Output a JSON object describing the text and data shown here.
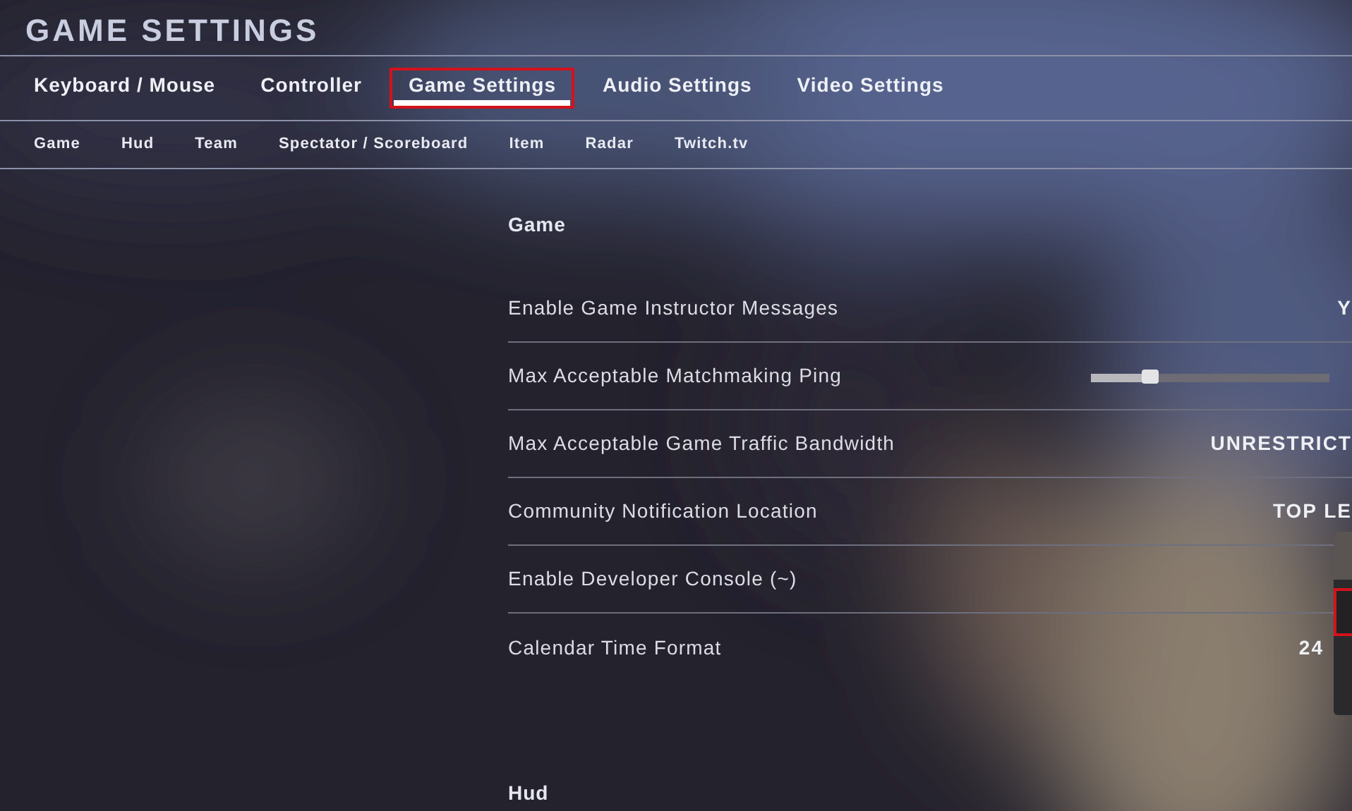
{
  "title": "GAME SETTINGS",
  "tabs": [
    {
      "label": "Keyboard / Mouse",
      "selected": false,
      "highlighted": false
    },
    {
      "label": "Controller",
      "selected": false,
      "highlighted": false
    },
    {
      "label": "Game Settings",
      "selected": true,
      "highlighted": true
    },
    {
      "label": "Audio Settings",
      "selected": false,
      "highlighted": false
    },
    {
      "label": "Video Settings",
      "selected": false,
      "highlighted": false
    }
  ],
  "subtabs": [
    {
      "label": "Game"
    },
    {
      "label": "Hud"
    },
    {
      "label": "Team"
    },
    {
      "label": "Spectator / Scoreboard"
    },
    {
      "label": "Item"
    },
    {
      "label": "Radar"
    },
    {
      "label": "Twitch.tv"
    }
  ],
  "section": {
    "title": "Game"
  },
  "settings": [
    {
      "kind": "value",
      "label": "Enable Game Instructor Messages",
      "value": "Y"
    },
    {
      "kind": "slider",
      "label": "Max Acceptable Matchmaking Ping",
      "level": 0.25
    },
    {
      "kind": "value",
      "label": "Max Acceptable Game Traffic Bandwidth",
      "value": "UNRESTRICT"
    },
    {
      "kind": "value",
      "label": "Community Notification Location",
      "value": "TOP LE"
    },
    {
      "kind": "dropdown",
      "label": "Enable Developer Console (~)",
      "popup": {
        "options": [
          {
            "selected": true
          },
          {
            "selected": false
          }
        ]
      }
    },
    {
      "kind": "value",
      "label": "Calendar Time Format",
      "value": "24"
    }
  ],
  "next_section": {
    "title": "Hud"
  }
}
